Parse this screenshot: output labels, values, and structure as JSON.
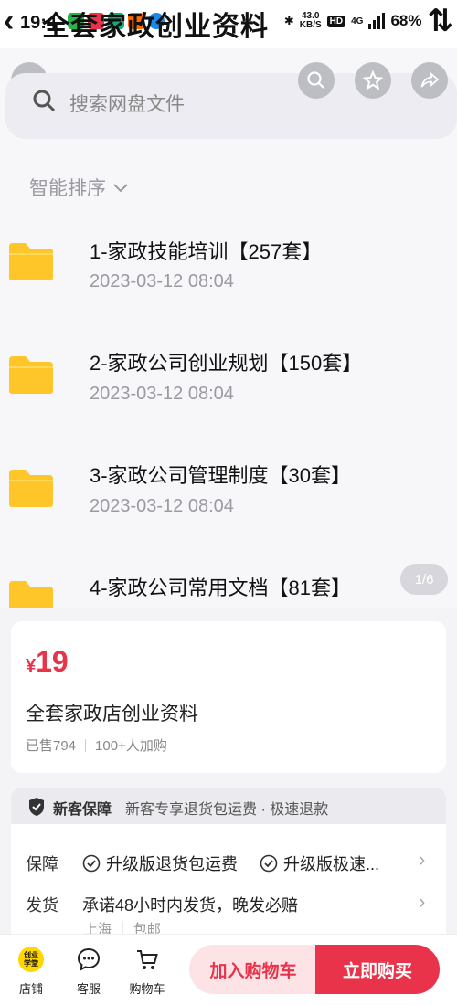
{
  "status_bar": {
    "time": "19:4",
    "title": "全套家政创业资料",
    "net_speed_value": "43.0",
    "net_speed_unit": "KB/S",
    "hd_badge": "HD",
    "signal_type": "4G",
    "battery": "68%"
  },
  "header": {
    "back_icon": "chevron-left-icon",
    "search_icon": "search-icon",
    "favorite_icon": "star-icon",
    "share_icon": "share-arrow-icon"
  },
  "search": {
    "placeholder": "搜索网盘文件"
  },
  "sort": {
    "label": "智能排序"
  },
  "files": [
    {
      "name": "1-家政技能培训【257套】",
      "date": "2023-03-12  08:04"
    },
    {
      "name": "2-家政公司创业规划【150套】",
      "date": "2023-03-12  08:04"
    },
    {
      "name": "3-家政公司管理制度【30套】",
      "date": "2023-03-12  08:04"
    },
    {
      "name": "4-家政公司常用文档【81套】"
    }
  ],
  "pager": {
    "label": "1/6"
  },
  "product": {
    "currency": "¥",
    "price": "19",
    "title": "全套家政店创业资料",
    "sold": "已售794",
    "added": "100+人加购"
  },
  "guarantee": {
    "title": "新客保障",
    "desc": "新客专享退货包运费 · 极速退款"
  },
  "services": {
    "guarantee_label": "保障",
    "guarantee_items": [
      "升级版退货包运费",
      "升级版极速..."
    ],
    "shipping_label": "发货",
    "shipping_text": "承诺48小时内发货，晚发必赔",
    "shipping_from": "上海",
    "shipping_fee": "包邮"
  },
  "bottom_bar": {
    "shop_logo_line1": "创业",
    "shop_logo_line2": "学堂",
    "shop": "店铺",
    "service": "客服",
    "cart": "购物车",
    "add_to_cart": "加入购物车",
    "buy_now": "立即购买"
  },
  "colors": {
    "accent": "#e8334a",
    "folder": "#ffc629"
  }
}
